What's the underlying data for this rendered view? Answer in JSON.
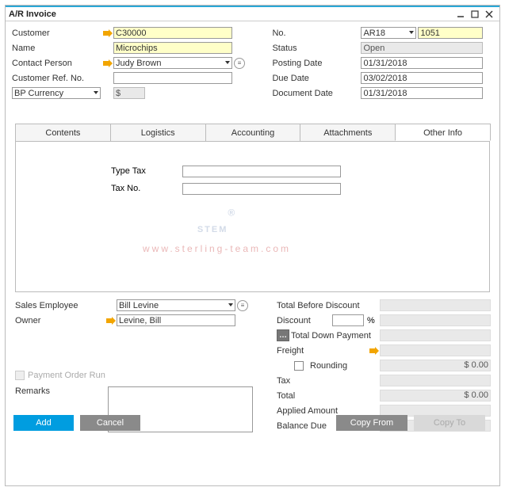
{
  "window": {
    "title": "A/R Invoice"
  },
  "left": {
    "customer_lbl": "Customer",
    "customer_val": "C30000",
    "name_lbl": "Name",
    "name_val": "Microchips",
    "contact_lbl": "Contact Person",
    "contact_val": "Judy Brown",
    "ref_lbl": "Customer Ref. No.",
    "ref_val": "",
    "currency_lbl": "BP Currency",
    "currency_val": "$"
  },
  "right": {
    "no_lbl": "No.",
    "series_val": "AR18",
    "docnum_val": "1051",
    "status_lbl": "Status",
    "status_val": "Open",
    "posting_lbl": "Posting Date",
    "posting_val": "01/31/2018",
    "due_lbl": "Due Date",
    "due_val": "03/02/2018",
    "docdate_lbl": "Document Date",
    "docdate_val": "01/31/2018"
  },
  "tabs": {
    "contents": "Contents",
    "logistics": "Logistics",
    "accounting": "Accounting",
    "attachments": "Attachments",
    "otherinfo": "Other Info"
  },
  "otherinfo": {
    "typetax_lbl": "Type Tax",
    "typetax_val": "",
    "taxno_lbl": "Tax No.",
    "taxno_val": ""
  },
  "watermark": {
    "text": "STEM",
    "url": "www.sterling-team.com"
  },
  "lowerleft": {
    "salesemp_lbl": "Sales Employee",
    "salesemp_val": "Bill Levine",
    "owner_lbl": "Owner",
    "owner_val": "Levine, Bill",
    "payment_run_lbl": "Payment Order Run",
    "remarks_lbl": "Remarks",
    "remarks_val": ""
  },
  "totals": {
    "before_disc": "Total Before Discount",
    "discount": "Discount",
    "pct": "%",
    "down_payment": "Total Down Payment",
    "freight": "Freight",
    "rounding": "Rounding",
    "rounding_val": "$ 0.00",
    "tax": "Tax",
    "total": "Total",
    "total_val": "$ 0.00",
    "applied": "Applied Amount",
    "balance": "Balance Due"
  },
  "buttons": {
    "add": "Add",
    "cancel": "Cancel",
    "copy_from": "Copy From",
    "copy_to": "Copy To"
  }
}
